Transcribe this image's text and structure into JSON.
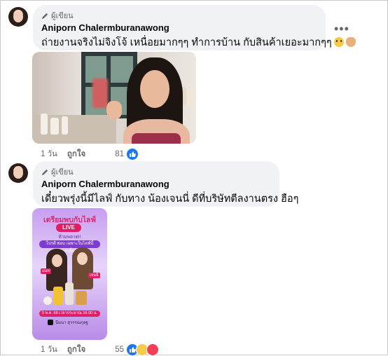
{
  "comments": [
    {
      "role": "ผู้เขียน",
      "author": "Aniporn Chalermburanawong",
      "text": "ถ่ายงานจริงไม่จิงโจ้ เหนื่อยมากๆๆ ทำการบ้าน กับสินค้าเยอะมากๆๆ",
      "emojis": [
        "smiling-face-icon",
        "folded-hands-icon"
      ],
      "time": "1 วัน",
      "like_label": "ถูกใจ",
      "reaction_count": "81",
      "reactions": [
        "like-reaction-icon"
      ]
    },
    {
      "role": "ผู้เขียน",
      "author": "Aniporn Chalermburanawong",
      "text": "เดี๋ยวพรุ่งนี้มีไลฟ์ กับทาง น้องเจนนี่ ดีที่บริษัทตีลงานตรง ฮือๆ",
      "time": "1 วัน",
      "like_label": "ถูกใจ",
      "reaction_count": "55",
      "reactions": [
        "like-reaction-icon",
        "care-reaction-icon",
        "love-reaction-icon"
      ]
    }
  ],
  "poster": {
    "headline": "เตรียมพบกับไลฟ์",
    "live_badge": "LIVE",
    "subhead": "ห้ามพลาด!!",
    "banner": "โปรดี พ่อบ เฉพาะในไลฟ์นี้เท่านั้น!!",
    "tag_left": "แนท",
    "tag_right": "เจนนี่",
    "date": "5 พ.ค. 68 เวลาประมาณ 16.00 น.",
    "channel": "นีมนา สุวรรณกุลฐ"
  },
  "colors": {
    "bubble": "#f0f2f5",
    "meta_text": "#65676b",
    "like_blue": "#1877f2"
  }
}
